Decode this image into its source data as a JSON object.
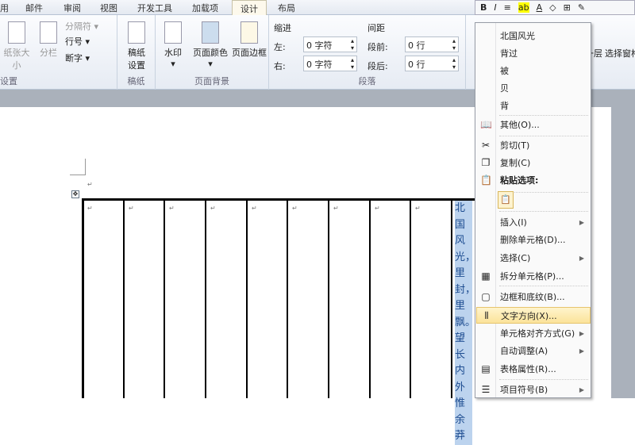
{
  "tabs": [
    "用",
    "邮件",
    "审阅",
    "视图",
    "开发工具",
    "加载项",
    "设计",
    "布局"
  ],
  "ribbon": {
    "page_setup": {
      "paper_size": "纸张大小",
      "columns": "分栏",
      "breaks": "分隔符",
      "line_numbers": "行号",
      "hyphenation": "断字",
      "label": "设置"
    },
    "manuscript": {
      "setup_line1": "稿纸",
      "setup_line2": "设置",
      "label": "稿纸"
    },
    "page_background": {
      "watermark": "水印",
      "page_color": "页面颜色",
      "page_borders": "页面边框",
      "label": "页面背景"
    },
    "paragraph": {
      "indent": "缩进",
      "left": "左:",
      "left_value": "0 字符",
      "right": "右:",
      "right_value": "0 字符",
      "spacing": "间距",
      "before": "段前:",
      "before_value": "0 行",
      "after": "段后:",
      "after_value": "0 行",
      "label": "段落"
    },
    "arrange": {
      "send_back": "下移一层",
      "selection_pane": "选择窗格"
    }
  },
  "mini_toolbar": [
    "B",
    "I",
    "≡",
    "ab",
    "A",
    "◇",
    "⊞",
    "✎"
  ],
  "document": {
    "cell_text": "北国风光，里封，里飘。望长内外惟余莽",
    "return_mark": "↵"
  },
  "context_menu": {
    "items": [
      {
        "label": "北国风光"
      },
      {
        "label": "背过"
      },
      {
        "label": "被"
      },
      {
        "label": "贝"
      },
      {
        "label": "背"
      },
      {
        "label": "其他(O)...",
        "icon": "book-icon"
      },
      {
        "label": "剪切(T)",
        "icon": "scissors-icon"
      },
      {
        "label": "复制(C)",
        "icon": "copy-icon"
      },
      {
        "label": "粘贴选项:",
        "icon": "paste-icon"
      },
      {
        "label": "插入(I)",
        "submenu": true
      },
      {
        "label": "删除单元格(D)..."
      },
      {
        "label": "选择(C)",
        "submenu": true
      },
      {
        "label": "拆分单元格(P)...",
        "icon": "split-cells-icon"
      },
      {
        "label": "边框和底纹(B)...",
        "icon": "borders-icon"
      },
      {
        "label": "文字方向(X)...",
        "icon": "text-direction-icon",
        "highlighted": true
      },
      {
        "label": "单元格对齐方式(G)",
        "submenu": true
      },
      {
        "label": "自动调整(A)",
        "submenu": true
      },
      {
        "label": "表格属性(R)...",
        "icon": "table-properties-icon"
      },
      {
        "label": "项目符号(B)",
        "icon": "bullets-icon",
        "submenu": true
      }
    ],
    "submenu_arrow": "▶"
  },
  "colors": {
    "highlight": "#fbe39a",
    "selection": "#bcd3ee"
  }
}
